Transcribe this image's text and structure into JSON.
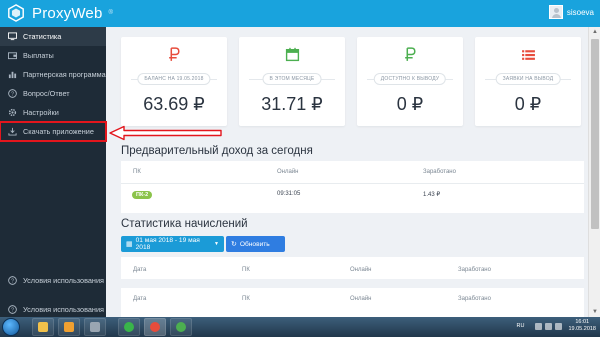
{
  "app": {
    "name": "ProxyWeb",
    "badge": "®"
  },
  "user": {
    "name": "sisoeva"
  },
  "sidebar": {
    "items": [
      {
        "label": "Статистика",
        "icon": "monitor-icon"
      },
      {
        "label": "Выплаты",
        "icon": "wallet-icon"
      },
      {
        "label": "Партнерская программа",
        "icon": "chart-icon"
      },
      {
        "label": "Вопрос/Ответ",
        "icon": "question-icon"
      },
      {
        "label": "Настройки",
        "icon": "gear-icon"
      },
      {
        "label": "Скачать приложение",
        "icon": "download-icon"
      }
    ],
    "footer": [
      {
        "label": "Условия использования",
        "icon": "question-icon"
      },
      {
        "label": "Условия использования",
        "icon": "question-icon"
      }
    ]
  },
  "stats": [
    {
      "label": "БАЛАНС НА 19.05.2018",
      "value": "63.69 ₽",
      "icon": "ruble-icon",
      "color": "#e74c3c"
    },
    {
      "label": "В ЭТОМ МЕСЯЦЕ",
      "value": "31.71 ₽",
      "icon": "calendar-icon",
      "color": "#4caf50"
    },
    {
      "label": "ДОСТУПНО К ВЫВОДУ",
      "value": "0 ₽",
      "icon": "ruble-icon",
      "color": "#4caf50"
    },
    {
      "label": "ЗАЯВКИ НА ВЫВОД",
      "value": "0 ₽",
      "icon": "list-icon",
      "color": "#e74c3c"
    }
  ],
  "prelim": {
    "title": "Предварительный доход за сегодня",
    "headers": [
      "ПК",
      "Онлайн",
      "Заработано"
    ],
    "row": {
      "pc": "ПК-2",
      "online": "09:31:05",
      "earned": "1.43 ₽"
    }
  },
  "accruals": {
    "title": "Статистика начислений",
    "date_range": "01 мая 2018 - 19 мая 2018",
    "refresh_label": "Обновить",
    "headers": [
      "Дата",
      "ПК",
      "Онлайн",
      "Заработано"
    ]
  },
  "taskbar": {
    "lang": "RU",
    "time": "16:01",
    "date": "19.05.2018",
    "apps": [
      {
        "name": "explorer-icon",
        "color": "#f1c14b"
      },
      {
        "name": "media-player-icon",
        "color": "#f0a030"
      },
      {
        "name": "network-icon",
        "color": "#9aa6b2"
      },
      {
        "name": "mail-icon",
        "color": "#39b54a"
      },
      {
        "name": "chrome-icon",
        "color": "#e74c3c"
      },
      {
        "name": "chrome-icon",
        "color": "#4caf50"
      }
    ]
  }
}
